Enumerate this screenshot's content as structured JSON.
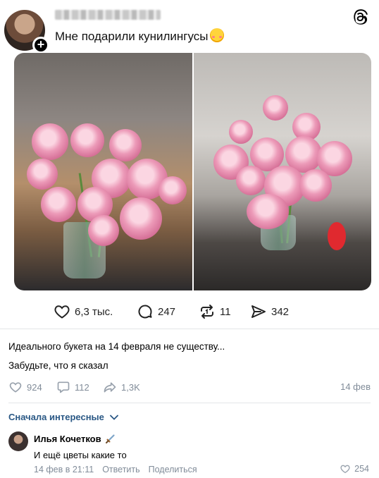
{
  "threads_post": {
    "text": "Мне подарили кунилингусы",
    "likes": "6,3 тыс.",
    "replies": "247",
    "reposts": "11",
    "shares": "342"
  },
  "vk_post": {
    "line1": "Идеального букета на 14 февраля не существу...",
    "line2": "Забудьте, что я сказал",
    "likes": "924",
    "comments": "112",
    "shares": "1,3K",
    "date": "14 фев"
  },
  "comments": {
    "sort_label": "Сначала интересные",
    "items": [
      {
        "author": "Илья Кочетков",
        "text": "И ещё цветы какие то",
        "time": "14 фев в 21:11",
        "reply": "Ответить",
        "share": "Поделиться",
        "likes": "254"
      }
    ]
  },
  "colors": {
    "vk_link": "#2a5885",
    "vk_meta": "#818c99",
    "divider": "#e3e5e8"
  },
  "icons": [
    "threads-logo-icon",
    "heart-icon",
    "reply-icon",
    "repost-icon",
    "send-icon",
    "comment-icon",
    "share-icon",
    "chevron-down-icon",
    "sword-icon",
    "plus-icon"
  ]
}
